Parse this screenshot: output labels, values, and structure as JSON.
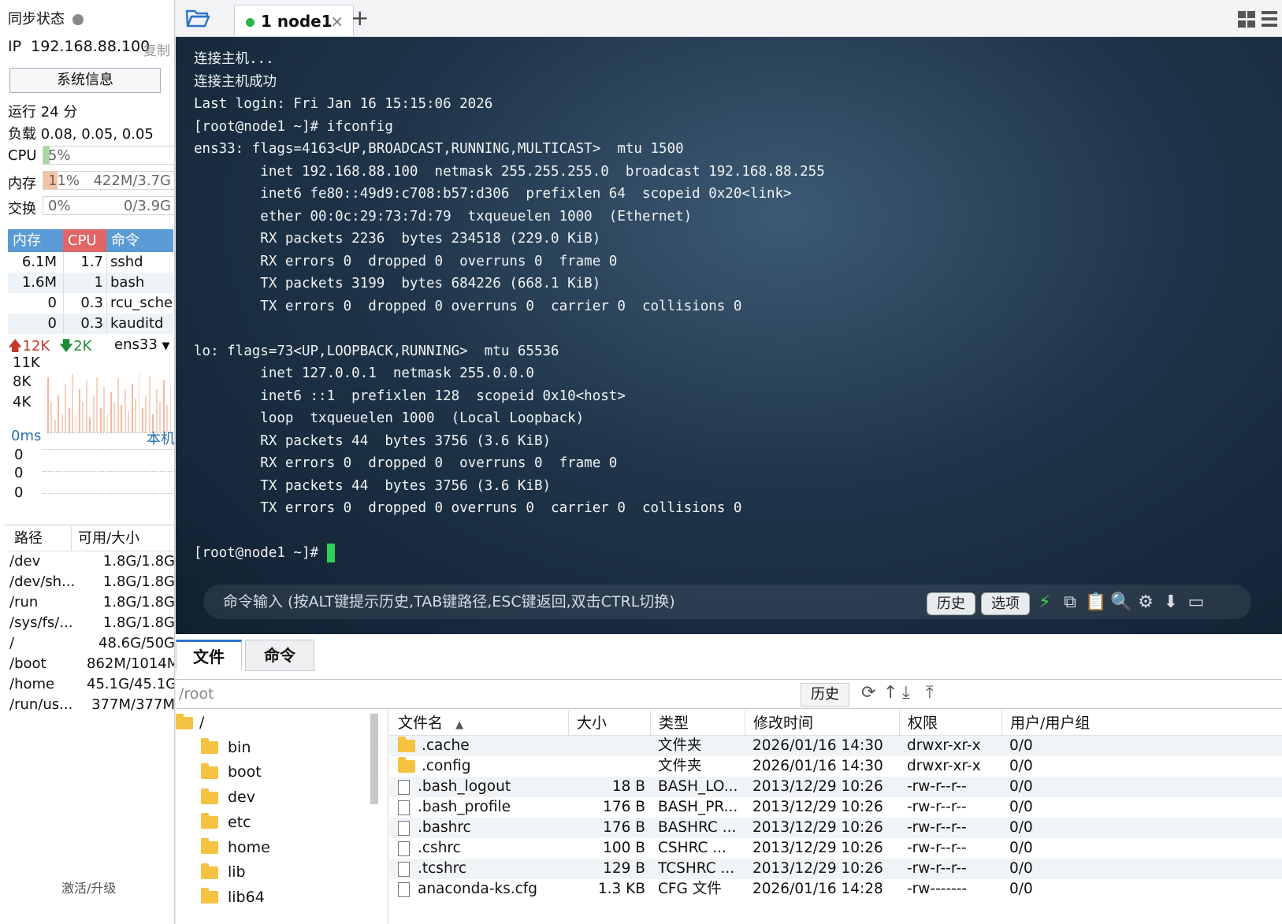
{
  "sidebar": {
    "sync_label": "同步状态",
    "ip_label": "IP",
    "ip_value": "192.168.88.100",
    "copy_label": "复制",
    "sysinfo_button": "系统信息",
    "uptime": "运行 24 分",
    "load": "负载 0.08, 0.05, 0.05",
    "cpu": {
      "label": "CPU",
      "pct": "5%",
      "fraction": 0.05,
      "color": "#a6d9a0"
    },
    "mem": {
      "label": "内存",
      "pct": "11%",
      "amount": "422M/3.7G",
      "fraction": 0.11,
      "color": "#f5c3a1"
    },
    "swap": {
      "label": "交换",
      "pct": "0%",
      "amount": "0/3.9G",
      "fraction": 0.0
    },
    "proc_headers": [
      "内存",
      "CPU",
      "命令"
    ],
    "proc_header_colors": [
      "#5b9bd5",
      "#e06666",
      "#5b9bd5"
    ],
    "processes": [
      {
        "mem": "6.1M",
        "cpu": "1.7",
        "cmd": "sshd"
      },
      {
        "mem": "1.6M",
        "cpu": "1",
        "cmd": "bash"
      },
      {
        "mem": "0",
        "cpu": "0.3",
        "cmd": "rcu_sched"
      },
      {
        "mem": "0",
        "cpu": "0.3",
        "cmd": "kauditd"
      }
    ],
    "net": {
      "up": "12K",
      "down": "2K",
      "iface": "ens33",
      "y_labels": [
        "11K",
        "8K",
        "4K"
      ],
      "up_color": "#c0392b",
      "down_color": "#1e8c3a",
      "samples": [
        0.9,
        0.5,
        0.2,
        0.6,
        0.3,
        0.8,
        0.4,
        0.95,
        0.3,
        0.7,
        0.5,
        0.85,
        0.25,
        0.6,
        0.9,
        0.4,
        0.75,
        0.3,
        0.65,
        0.5,
        0.88,
        0.45,
        0.7,
        0.35,
        0.8,
        0.55,
        0.95,
        0.4,
        0.6,
        0.92,
        0.3,
        0.7,
        0.5,
        0.85,
        0.45,
        0.75
      ]
    },
    "ping": {
      "label": "0ms",
      "host": "本机",
      "values": [
        "0",
        "0",
        "0"
      ]
    },
    "disk_headers": [
      "路径",
      "可用/大小"
    ],
    "disks": [
      {
        "path": "/dev",
        "size": "1.8G/1.8G"
      },
      {
        "path": "/dev/sh...",
        "size": "1.8G/1.8G"
      },
      {
        "path": "/run",
        "size": "1.8G/1.8G"
      },
      {
        "path": "/sys/fs/...",
        "size": "1.8G/1.8G"
      },
      {
        "path": "/",
        "size": "48.6G/50G"
      },
      {
        "path": "/boot",
        "size": "862M/1014M"
      },
      {
        "path": "/home",
        "size": "45.1G/45.1G"
      },
      {
        "path": "/run/us...",
        "size": "377M/377M"
      }
    ],
    "activate": "激活/升级"
  },
  "tabs": {
    "session_tab": "1  node1",
    "close": "×",
    "add": "+"
  },
  "terminal": {
    "lines": [
      "连接主机...",
      "连接主机成功",
      "Last login: Fri Jan 16 15:15:06 2026",
      "[root@node1 ~]# ifconfig",
      "ens33: flags=4163<UP,BROADCAST,RUNNING,MULTICAST>  mtu 1500",
      "        inet 192.168.88.100  netmask 255.255.255.0  broadcast 192.168.88.255",
      "        inet6 fe80::49d9:c708:b57:d306  prefixlen 64  scopeid 0x20<link>",
      "        ether 00:0c:29:73:7d:79  txqueuelen 1000  (Ethernet)",
      "        RX packets 2236  bytes 234518 (229.0 KiB)",
      "        RX errors 0  dropped 0  overruns 0  frame 0",
      "        TX packets 3199  bytes 684226 (668.1 KiB)",
      "        TX errors 0  dropped 0 overruns 0  carrier 0  collisions 0",
      "",
      "lo: flags=73<UP,LOOPBACK,RUNNING>  mtu 65536",
      "        inet 127.0.0.1  netmask 255.0.0.0",
      "        inet6 ::1  prefixlen 128  scopeid 0x10<host>",
      "        loop  txqueuelen 1000  (Local Loopback)",
      "        RX packets 44  bytes 3756 (3.6 KiB)",
      "        RX errors 0  dropped 0  overruns 0  frame 0",
      "        TX packets 44  bytes 3756 (3.6 KiB)",
      "        TX errors 0  dropped 0 overruns 0  carrier 0  collisions 0",
      ""
    ],
    "prompt": "[root@node1 ~]# ",
    "cmd_placeholder": "命令输入 (按ALT键提示历史,TAB键路径,ESC键返回,双击CTRL切换)",
    "history_button": "历史",
    "options_button": "选项"
  },
  "files": {
    "tab_files": "文件",
    "tab_commands": "命令",
    "path": "/root",
    "history_button": "历史",
    "tree": [
      "/",
      "bin",
      "boot",
      "dev",
      "etc",
      "home",
      "lib",
      "lib64"
    ],
    "headers": [
      "文件名",
      "大小",
      "类型",
      "修改时间",
      "权限",
      "用户/用户组"
    ],
    "rows": [
      {
        "name": ".cache",
        "size": "",
        "type": "文件夹",
        "mtime": "2026/01/16 14:30",
        "perm": "drwxr-xr-x",
        "owner": "0/0",
        "folder": true
      },
      {
        "name": ".config",
        "size": "",
        "type": "文件夹",
        "mtime": "2026/01/16 14:30",
        "perm": "drwxr-xr-x",
        "owner": "0/0",
        "folder": true
      },
      {
        "name": ".bash_logout",
        "size": "18 B",
        "type": "BASH_LO...",
        "mtime": "2013/12/29 10:26",
        "perm": "-rw-r--r--",
        "owner": "0/0",
        "folder": false
      },
      {
        "name": ".bash_profile",
        "size": "176 B",
        "type": "BASH_PR...",
        "mtime": "2013/12/29 10:26",
        "perm": "-rw-r--r--",
        "owner": "0/0",
        "folder": false
      },
      {
        "name": ".bashrc",
        "size": "176 B",
        "type": "BASHRC ...",
        "mtime": "2013/12/29 10:26",
        "perm": "-rw-r--r--",
        "owner": "0/0",
        "folder": false
      },
      {
        "name": ".cshrc",
        "size": "100 B",
        "type": "CSHRC ...",
        "mtime": "2013/12/29 10:26",
        "perm": "-rw-r--r--",
        "owner": "0/0",
        "folder": false
      },
      {
        "name": ".tcshrc",
        "size": "129 B",
        "type": "TCSHRC ...",
        "mtime": "2013/12/29 10:26",
        "perm": "-rw-r--r--",
        "owner": "0/0",
        "folder": false
      },
      {
        "name": "anaconda-ks.cfg",
        "size": "1.3 KB",
        "type": "CFG 文件",
        "mtime": "2026/01/16 14:28",
        "perm": "-rw-------",
        "owner": "0/0",
        "folder": false
      }
    ]
  }
}
